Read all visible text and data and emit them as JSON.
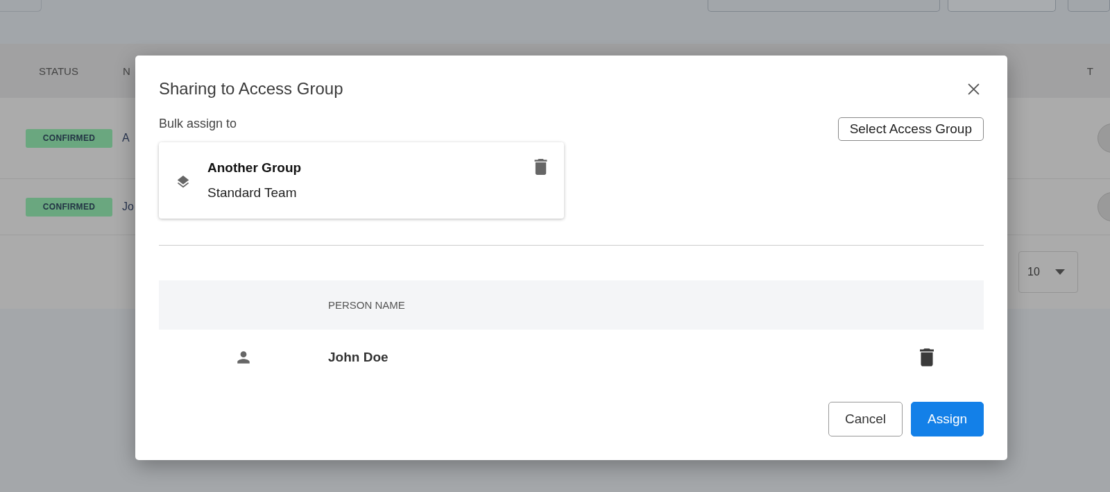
{
  "background": {
    "table": {
      "columns": [
        "STATUS",
        "N",
        "T"
      ],
      "rows": [
        {
          "status": "CONFIRMED",
          "name": "A"
        },
        {
          "status": "CONFIRMED",
          "name": "Jo"
        }
      ]
    },
    "pagination": {
      "page_size": "10"
    }
  },
  "dialog": {
    "title": "Sharing to Access Group",
    "bulk_label": "Bulk assign to",
    "select_button": "Select Access Group",
    "group_card": {
      "name": "Another Group",
      "type": "Standard Team"
    },
    "table": {
      "columns": [
        "PERSON NAME"
      ],
      "rows": [
        {
          "name": "John Doe"
        }
      ]
    },
    "buttons": [
      {
        "label": "Cancel",
        "kind": "secondary"
      },
      {
        "label": "Assign",
        "kind": "primary"
      }
    ]
  }
}
